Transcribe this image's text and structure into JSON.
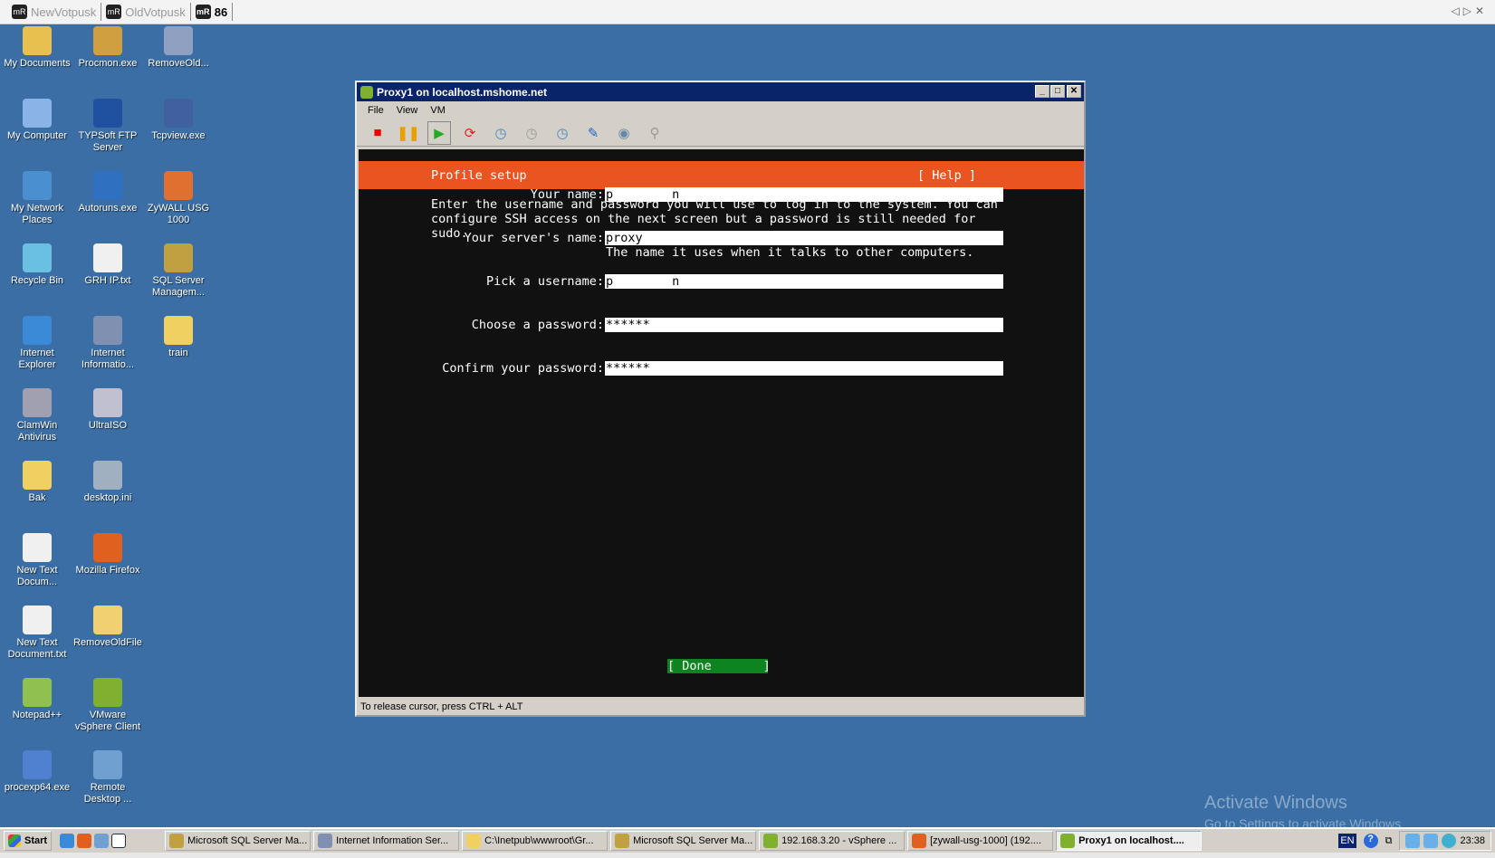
{
  "top_tabs": [
    {
      "label": "NewVotpusk",
      "active": false
    },
    {
      "label": "OldVotpusk",
      "active": false
    },
    {
      "label": "86",
      "active": true
    }
  ],
  "desktop_icons": [
    [
      {
        "label": "My Documents",
        "color": "#e8c050"
      },
      {
        "label": "My Computer",
        "color": "#8ab4e8"
      },
      {
        "label": "My Network Places",
        "color": "#4a90d0"
      },
      {
        "label": "Recycle Bin",
        "color": "#6ac0e0"
      },
      {
        "label": "Internet Explorer",
        "color": "#3a8ad8"
      },
      {
        "label": "ClamWin Antivirus",
        "color": "#a0a0b0"
      },
      {
        "label": "Bak",
        "color": "#f0d060"
      },
      {
        "label": "New Text Docum...",
        "color": "#f0f0f0"
      },
      {
        "label": "New Text Document.txt",
        "color": "#f0f0f0"
      },
      {
        "label": "Notepad++",
        "color": "#90c050"
      },
      {
        "label": "procexp64.exe",
        "color": "#5080d0"
      }
    ],
    [
      {
        "label": "Procmon.exe",
        "color": "#d0a040"
      },
      {
        "label": "TYPSoft FTP Server",
        "color": "#2050a0"
      },
      {
        "label": "Autoruns.exe",
        "color": "#3070c0"
      },
      {
        "label": "GRH IP.txt",
        "color": "#f0f0f0"
      },
      {
        "label": "Internet Informatio...",
        "color": "#8090b0"
      },
      {
        "label": "UltraISO",
        "color": "#c0c0d0"
      },
      {
        "label": "desktop.ini",
        "color": "#a0b0c0"
      },
      {
        "label": "Mozilla Firefox",
        "color": "#e06020"
      },
      {
        "label": "RemoveOldFile",
        "color": "#f0d070"
      },
      {
        "label": "VMware vSphere Client",
        "color": "#80b030"
      },
      {
        "label": "Remote Desktop ...",
        "color": "#70a0d0"
      }
    ],
    [
      {
        "label": "RemoveOld...",
        "color": "#90a0c0"
      },
      {
        "label": "Tcpview.exe",
        "color": "#4060a0"
      },
      {
        "label": "ZyWALL USG 1000",
        "color": "#e07030"
      },
      {
        "label": "SQL Server Managem...",
        "color": "#c0a040"
      },
      {
        "label": "train",
        "color": "#f0d060"
      }
    ]
  ],
  "vm_window": {
    "title": "Proxy1 on localhost.mshome.net",
    "menu": [
      "File",
      "View",
      "VM"
    ],
    "toolbar": [
      "stop-icon",
      "pause-icon",
      "play-icon",
      "reset-icon",
      "snapshot-icon",
      "revert-snapshot-icon",
      "snapshot-manager-icon",
      "edit-settings-icon",
      "cd-icon",
      "usb-icon"
    ],
    "status": "To release cursor, press CTRL + ALT"
  },
  "console": {
    "header_title": "Profile setup",
    "help": "[ Help ]",
    "intro": [
      "Enter the username and password you will use to log in to the system. You can",
      "configure SSH access on the next screen but a password is still needed for",
      "sudo."
    ],
    "fields": [
      {
        "label": "Your name:",
        "value": "p        n"
      },
      {
        "label": "Your server's name:",
        "value": "proxy",
        "hint": "The name it uses when it talks to other computers."
      },
      {
        "label": "Pick a username:",
        "value": "p        n"
      },
      {
        "label": "Choose a password:",
        "value": "******"
      },
      {
        "label": "Confirm your password:",
        "value": "******"
      }
    ],
    "done": "[ Done       ]",
    "accent": "#e95420"
  },
  "taskbar": {
    "start": "Start",
    "buttons": [
      {
        "label": "Microsoft SQL Server Ma...",
        "color": "#c0a040"
      },
      {
        "label": "Internet Information Ser...",
        "color": "#8090b0"
      },
      {
        "label": "C:\\Inetpub\\wwwroot\\Gr...",
        "color": "#f0d060"
      },
      {
        "label": "Microsoft SQL Server Ma...",
        "color": "#c0a040"
      },
      {
        "label": "192.168.3.20 - vSphere ...",
        "color": "#80b030"
      },
      {
        "label": "[zywall-usg-1000] (192....",
        "color": "#e06020"
      },
      {
        "label": "Proxy1 on localhost....",
        "color": "#80b030",
        "active": true
      }
    ],
    "lang": "EN",
    "clock": "23:38"
  },
  "watermark": {
    "title": "Activate Windows",
    "subtitle": "Go to Settings to activate Windows"
  }
}
